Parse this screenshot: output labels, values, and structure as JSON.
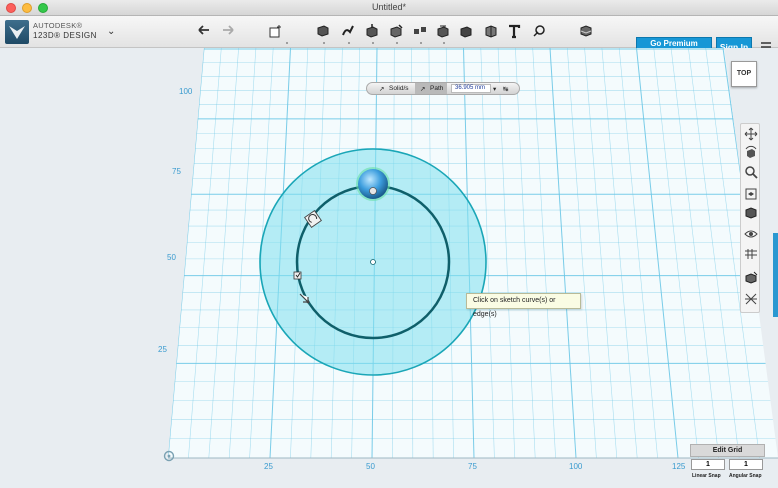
{
  "window": {
    "title": "Untitled*"
  },
  "app": {
    "brand": "AUTODESK®",
    "product": "123D® DESIGN"
  },
  "toolbar": {
    "undo_icon": "undo-arrow",
    "redo_icon": "redo-arrow",
    "tools": [
      "primitives",
      "sketch",
      "construct",
      "modify",
      "pattern",
      "grouping",
      "combine",
      "measure",
      "text",
      "snap",
      "material"
    ]
  },
  "premium": {
    "main": "Go Premium",
    "sub": "(FOR COMMERCIAL USE)"
  },
  "signin": {
    "label": "Sign In"
  },
  "mode_bar": {
    "solids": "Solid/s",
    "path": "Path",
    "distance": "36.905 mm"
  },
  "tooltip": {
    "text": "Click on sketch curve(s) or edge(s)"
  },
  "viewcube": {
    "face": "TOP"
  },
  "axis": {
    "y": [
      "100",
      "75",
      "50",
      "25"
    ],
    "x": [
      "25",
      "50",
      "75",
      "100",
      "125"
    ]
  },
  "grid": {
    "edit_label": "Edit Grid",
    "linear_snap_value": "1",
    "angular_snap_value": "1",
    "linear_snap_label": "Linear Snap",
    "angular_snap_label": "Angular Snap"
  },
  "colors": {
    "accent": "#1797d6",
    "grid": "#6cc6e6",
    "circle_fill": "#7fe0ee"
  }
}
